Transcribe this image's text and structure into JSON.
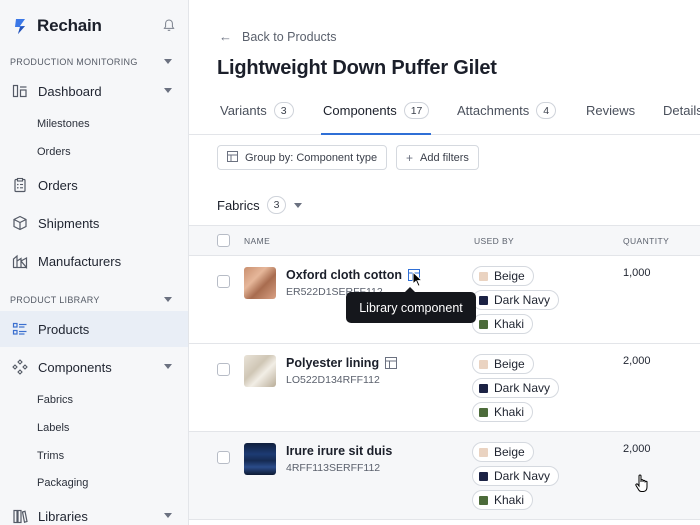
{
  "app": {
    "name": "Rechain"
  },
  "sidebar": {
    "sections": [
      {
        "label": "PRODUCTION MONITORING"
      },
      {
        "label": "PRODUCT LIBRARY"
      }
    ],
    "items": {
      "dashboard": "Dashboard",
      "milestones": "Milestones",
      "orders_sub": "Orders",
      "orders": "Orders",
      "shipments": "Shipments",
      "manufacturers": "Manufacturers",
      "products": "Products",
      "components": "Components",
      "fabrics": "Fabrics",
      "labels": "Labels",
      "trims": "Trims",
      "packaging": "Packaging",
      "libraries": "Libraries"
    },
    "active_item": "Products"
  },
  "main": {
    "back_label": "Back to Products",
    "title": "Lightweight Down Puffer Gilet",
    "tabs": [
      {
        "label": "Variants",
        "count": "3"
      },
      {
        "label": "Components",
        "count": "17"
      },
      {
        "label": "Attachments",
        "count": "4"
      },
      {
        "label": "Reviews"
      },
      {
        "label": "Details"
      }
    ],
    "active_tab": "Components",
    "toolbar": {
      "group_by": "Group by: Component type",
      "add_filters": "Add filters"
    },
    "group": {
      "label": "Fabrics",
      "count": "3"
    },
    "columns": {
      "name": "NAME",
      "used_by": "USED BY",
      "quantity": "QUANTITY"
    },
    "rows": [
      {
        "name": "Oxford cloth cotton",
        "code": "ER522D1SERFF112",
        "quantity": "1,000",
        "used_by": [
          {
            "label": "Beige",
            "color": "#ead3c1"
          },
          {
            "label": "Dark Navy",
            "color": "#1b2244"
          },
          {
            "label": "Khaki",
            "color": "#4c6b3a"
          }
        ]
      },
      {
        "name": "Polyester lining",
        "code": "LO522D134RFF112",
        "quantity": "2,000",
        "used_by": [
          {
            "label": "Beige",
            "color": "#ead3c1"
          },
          {
            "label": "Dark Navy",
            "color": "#1b2244"
          },
          {
            "label": "Khaki",
            "color": "#4c6b3a"
          }
        ]
      },
      {
        "name": "Irure irure sit duis",
        "code": "4RFF113SERFF112",
        "quantity": "2,000",
        "used_by": [
          {
            "label": "Beige",
            "color": "#ead3c1"
          },
          {
            "label": "Dark Navy",
            "color": "#1b2244"
          },
          {
            "label": "Khaki",
            "color": "#4c6b3a"
          }
        ]
      }
    ],
    "tooltip": "Library component"
  },
  "colors": {
    "accent": "#2f6fd6",
    "active_nav_bg": "#e9eef6",
    "sidebar_bg": "#f6f7f9"
  }
}
